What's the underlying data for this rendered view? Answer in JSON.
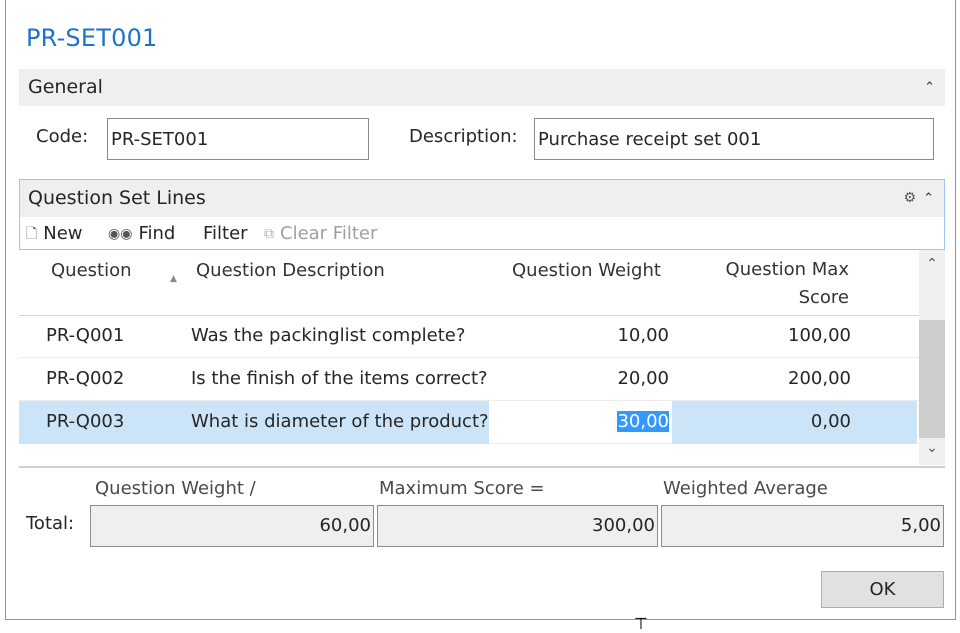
{
  "window": {
    "title": "PR-SET001"
  },
  "general": {
    "header": "General",
    "code_label": "Code:",
    "code_value": "PR-SET001",
    "description_label": "Description:",
    "description_value": "Purchase receipt set 001"
  },
  "lines": {
    "header": "Question Set Lines",
    "toolbar": {
      "new": "New",
      "find": "Find",
      "filter": "Filter",
      "clear_filter": "Clear Filter"
    },
    "columns": {
      "question": "Question",
      "description": "Question Description",
      "weight": "Question Weight",
      "max_score_1": "Question Max",
      "max_score_2": "Score"
    },
    "rows": [
      {
        "question": "PR-Q001",
        "description": "Was the packinglist complete?",
        "weight": "10,00",
        "max_score": "100,00"
      },
      {
        "question": "PR-Q002",
        "description": "Is the finish of the items correct?",
        "weight": "20,00",
        "max_score": "200,00"
      },
      {
        "question": "PR-Q003",
        "description": "What is diameter of the product?",
        "weight": "30,00",
        "max_score": "0,00"
      }
    ],
    "selected_row": 2
  },
  "totals": {
    "label": "Total:",
    "weight_caption": "Question Weight /",
    "max_caption": "Maximum Score =",
    "avg_caption": "Weighted Average",
    "weight_value": "60,00",
    "max_value": "300,00",
    "avg_value": "5,00"
  },
  "buttons": {
    "ok": "OK"
  },
  "colors": {
    "title_blue": "#1e72c8",
    "selection": "#cce4f7",
    "edit_highlight": "#3399ff"
  }
}
